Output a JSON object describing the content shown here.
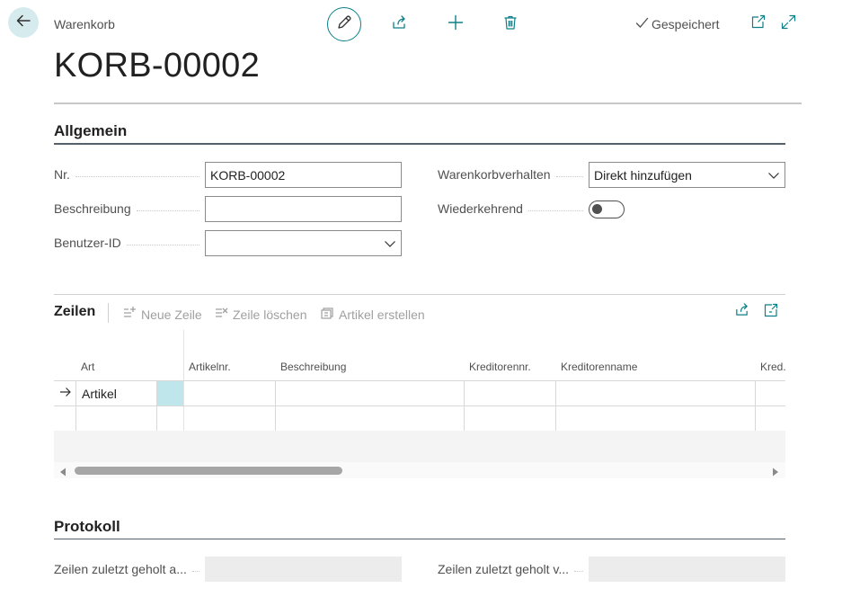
{
  "header": {
    "caption": "Warenkorb",
    "saved_label": "Gespeichert",
    "title": "KORB-00002"
  },
  "general": {
    "section_title": "Allgemein",
    "fields": {
      "nr_label": "Nr.",
      "nr_value": "KORB-00002",
      "beschreibung_label": "Beschreibung",
      "beschreibung_value": "",
      "benutzer_label": "Benutzer-ID",
      "benutzer_value": "",
      "verhalten_label": "Warenkorbverhalten",
      "verhalten_value": "Direkt hinzufügen",
      "wiederkehrend_label": "Wiederkehrend",
      "wiederkehrend_on": false
    }
  },
  "lines": {
    "title": "Zeilen",
    "actions": {
      "new": "Neue Zeile",
      "delete": "Zeile löschen",
      "create_item": "Artikel erstellen"
    },
    "columns": {
      "art": "Art",
      "artikelnr": "Artikelnr.",
      "beschreibung": "Beschreibung",
      "kreditorennr": "Kreditorennr.",
      "kreditorenname": "Kreditorenname",
      "kred": "Kred."
    },
    "rows": [
      {
        "art": "Artikel"
      },
      {
        "art": ""
      }
    ]
  },
  "protocol": {
    "section_title": "Protokoll",
    "field1_label": "Zeilen zuletzt geholt a...",
    "field2_label": "Zeilen zuletzt geholt v..."
  },
  "colors": {
    "accent": "#0e7f88",
    "back_button_bg": "#d6ebee",
    "selected_cell": "#bfe6ea"
  }
}
